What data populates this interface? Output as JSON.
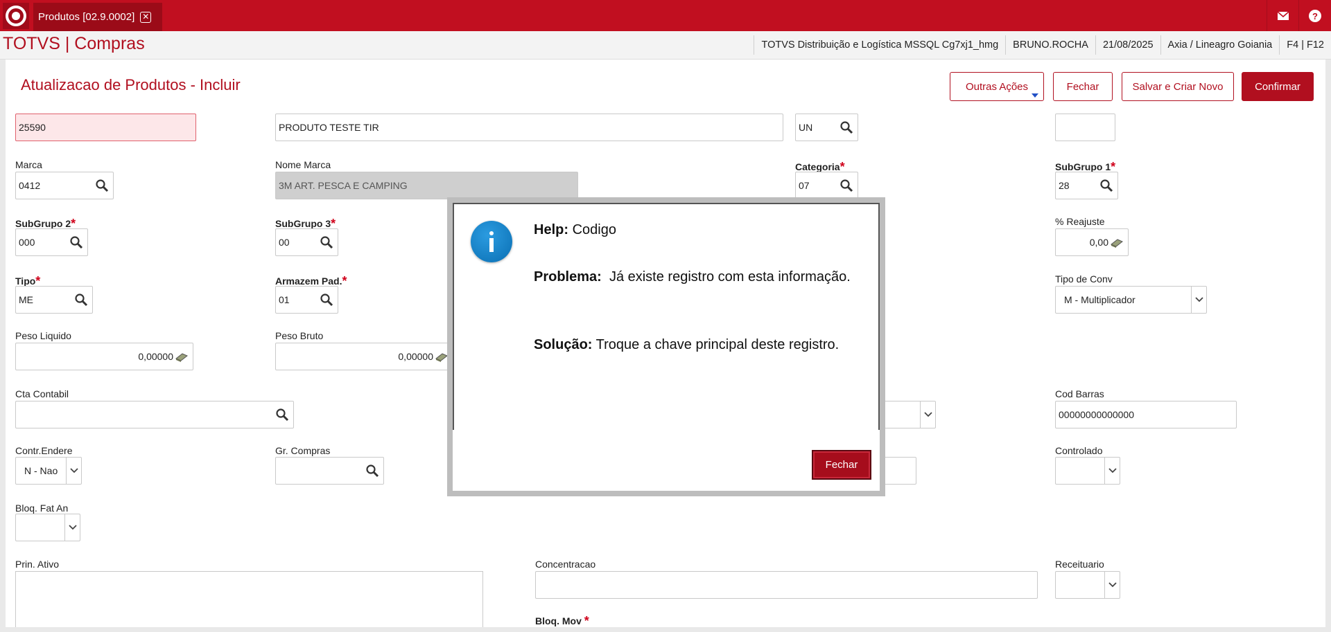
{
  "topbar": {
    "tab_label": "Produtos [02.9.0002]"
  },
  "header": {
    "app_title": "TOTVS | Compras",
    "info": [
      "TOTVS Distribuição e Logística MSSQL Cg7xj1_hmg",
      "BRUNO.ROCHA",
      "21/08/2025",
      "Axia / Lineagro Goiania",
      "F4 | F12"
    ]
  },
  "form": {
    "title": "Atualizacao de Produtos - Incluir",
    "buttons": {
      "outras": "Outras Ações",
      "fechar": "Fechar",
      "salvar": "Salvar e Criar Novo",
      "confirmar": "Confirmar"
    },
    "fields": {
      "codigo": {
        "value": "25590"
      },
      "descricao": {
        "value": "PRODUTO TESTE TIR"
      },
      "unidade": {
        "value": "UN"
      },
      "marca": {
        "label": "Marca",
        "value": "0412"
      },
      "nome_marca": {
        "label": "Nome Marca",
        "value": "3M ART. PESCA E CAMPING"
      },
      "categoria": {
        "label": "Categoria",
        "value": "07"
      },
      "subgrupo1": {
        "label": "SubGrupo 1",
        "value": "28"
      },
      "subgrupo2": {
        "label": "SubGrupo 2",
        "value": "000"
      },
      "subgrupo3": {
        "label": "SubGrupo 3",
        "value": "00"
      },
      "reajuste": {
        "label": "% Reajuste",
        "value": "0,00"
      },
      "tipo": {
        "label": "Tipo",
        "value": "ME"
      },
      "armazem": {
        "label": "Armazem Pad.",
        "value": "01"
      },
      "tipo_conv": {
        "label": "Tipo de Conv",
        "value": "M - Multiplicador"
      },
      "peso_liquido": {
        "label": "Peso Liquido",
        "value": "0,00000"
      },
      "peso_bruto": {
        "label": "Peso Bruto",
        "value": "0,00000"
      },
      "cta_contabil": {
        "label": "Cta Contabil",
        "value": ""
      },
      "cod_barras": {
        "label": "Cod Barras",
        "value": "00000000000000"
      },
      "contr_endere": {
        "label": "Contr.Endere",
        "value": "N - Nao"
      },
      "gr_compras": {
        "label": "Gr. Compras",
        "value": ""
      },
      "controlado": {
        "label": "Controlado",
        "value": ""
      },
      "bloq_fat": {
        "label": "Bloq. Fat An",
        "value": ""
      },
      "prin_ativo": {
        "label": "Prin. Ativo",
        "value": ""
      },
      "concentracao": {
        "label": "Concentracao",
        "value": ""
      },
      "receituario": {
        "label": "Receituario",
        "value": ""
      },
      "bloq_mov": {
        "label": "Bloq. Mov"
      }
    }
  },
  "dialog": {
    "help_label": "Help:",
    "help_text": "Codigo",
    "problema_label": "Problema:",
    "problema_text": "Já existe registro com esta informação.",
    "solucao_label": "Solução:",
    "solucao_text": "Troque a chave principal deste registro.",
    "close_label": "Fechar"
  },
  "colors": {
    "brand": "#c10f20",
    "info_blue": "#0a6fb3"
  }
}
